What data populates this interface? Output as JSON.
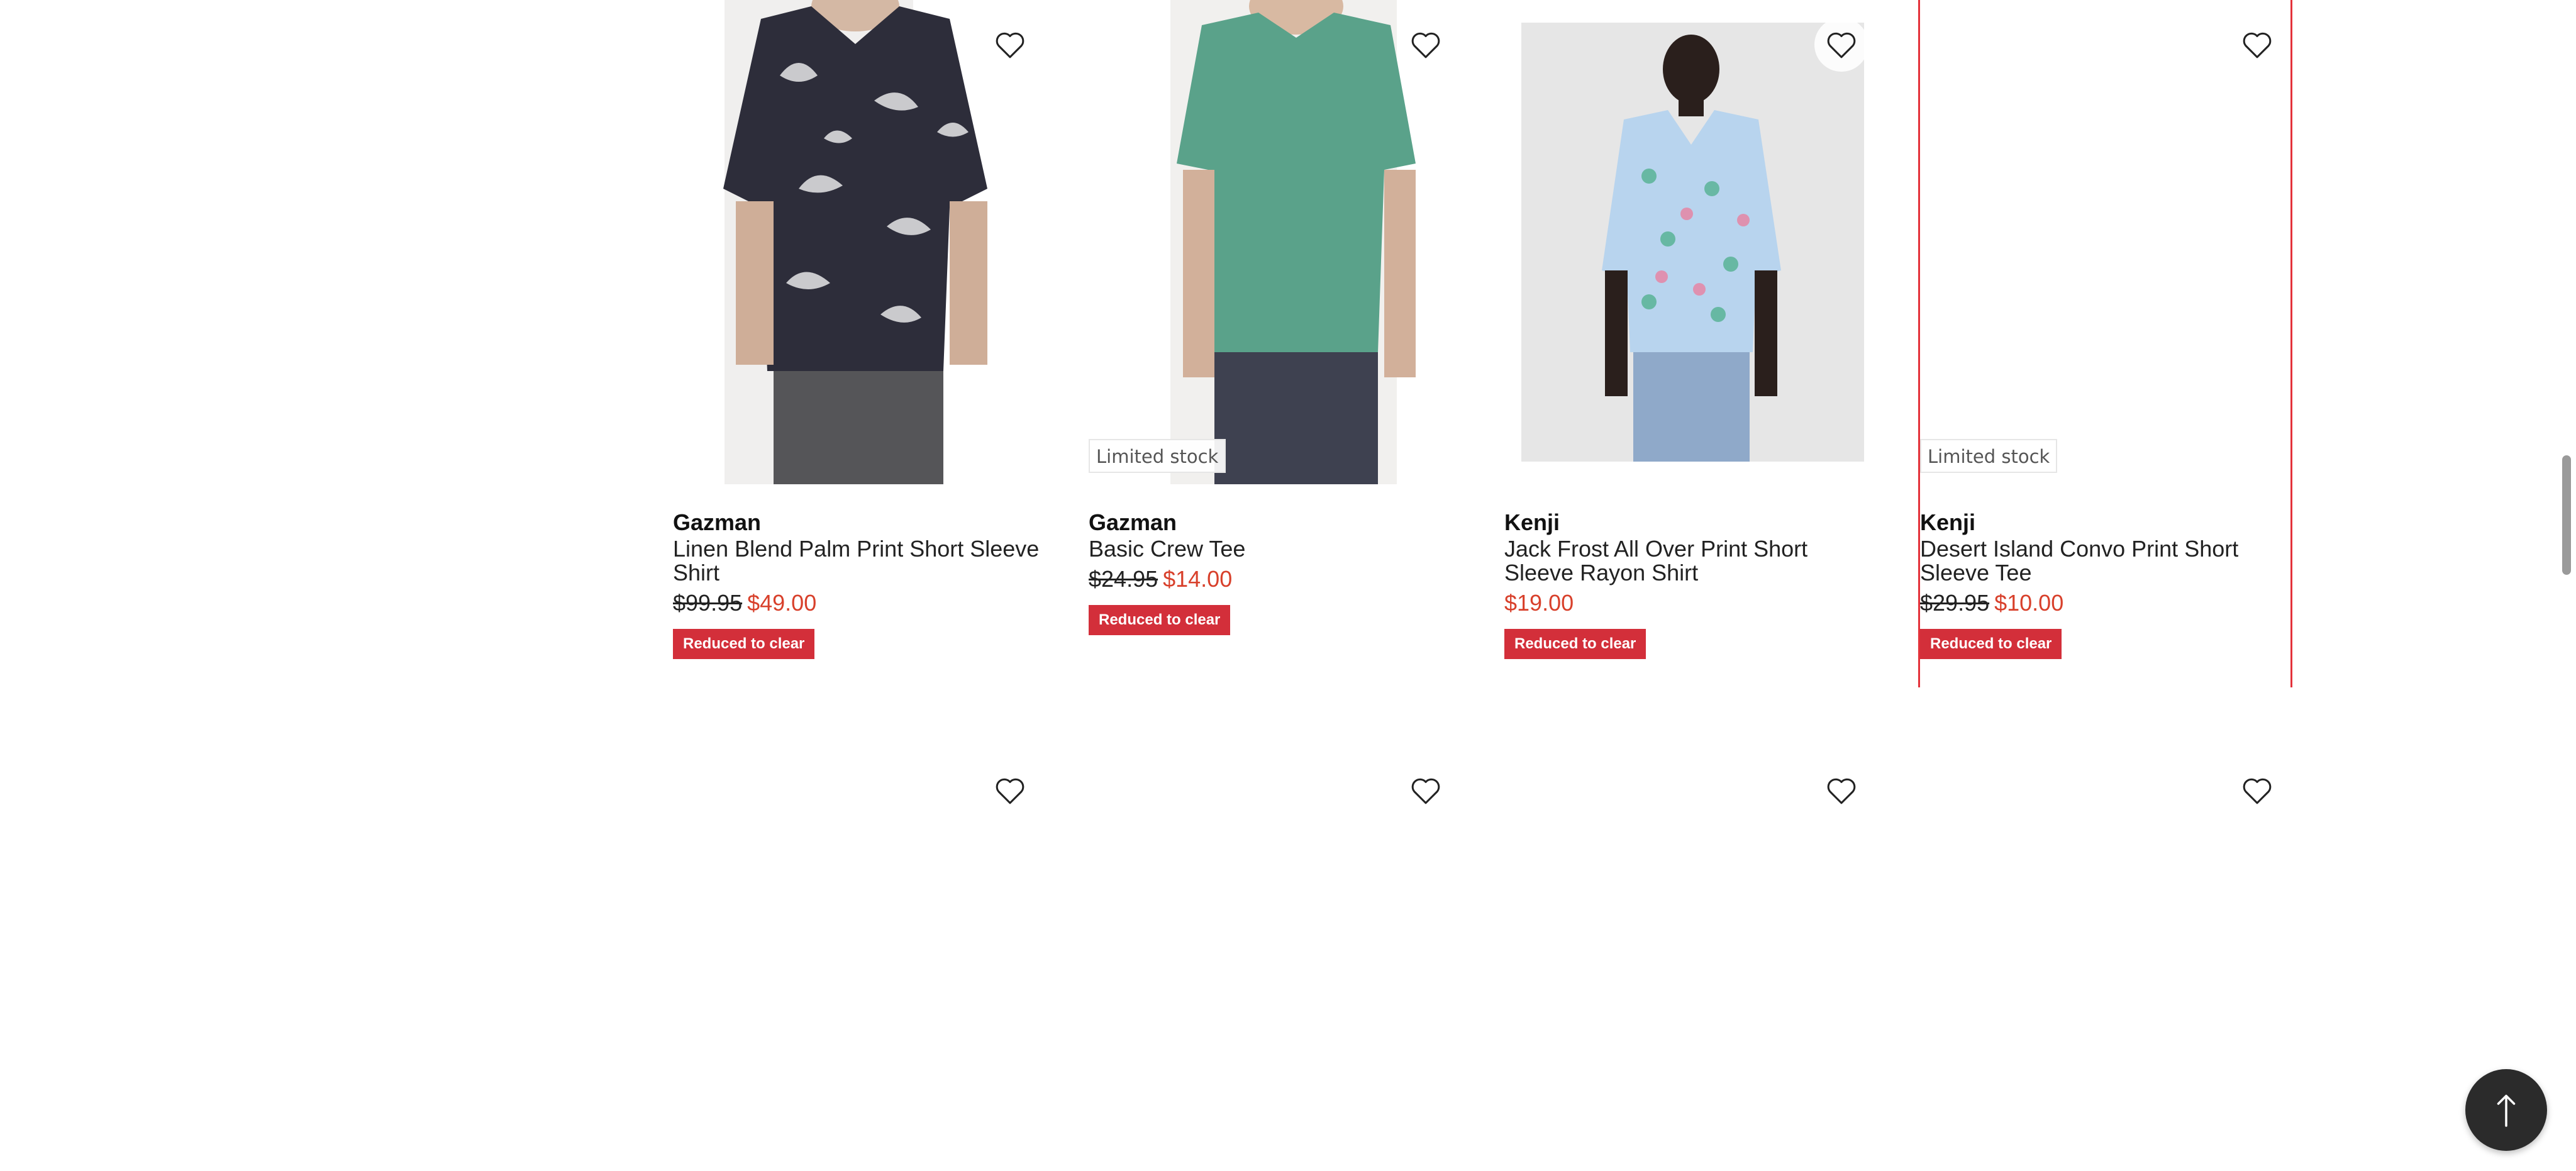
{
  "products": [
    {
      "brand": "Gazman",
      "title": "Linen Blend Palm Print Short Sleeve Shirt",
      "was_price": "$99.95",
      "price": "$49.00",
      "badge": "Reduced to clear",
      "limited": ""
    },
    {
      "brand": "Gazman",
      "title": "Basic Crew Tee",
      "was_price": "$24.95",
      "price": "$14.00",
      "badge": "Reduced to clear",
      "limited": "Limited stock"
    },
    {
      "brand": "Kenji",
      "title": "Jack Frost All Over Print Short Sleeve Rayon Shirt",
      "was_price": "",
      "price": "$19.00",
      "badge": "Reduced to clear",
      "limited": ""
    },
    {
      "brand": "Kenji",
      "title": "Desert Island Convo Print Short Sleeve Tee",
      "was_price": "$29.95",
      "price": "$10.00",
      "badge": "Reduced to clear",
      "limited": "Limited stock"
    }
  ],
  "icons": {
    "favourite": "heart-outline-icon",
    "back_to_top": "arrow-up-icon"
  },
  "colors": {
    "sale_price": "#d8402b",
    "badge_bg": "#d32f3a",
    "selected_outline": "#e4323a"
  }
}
